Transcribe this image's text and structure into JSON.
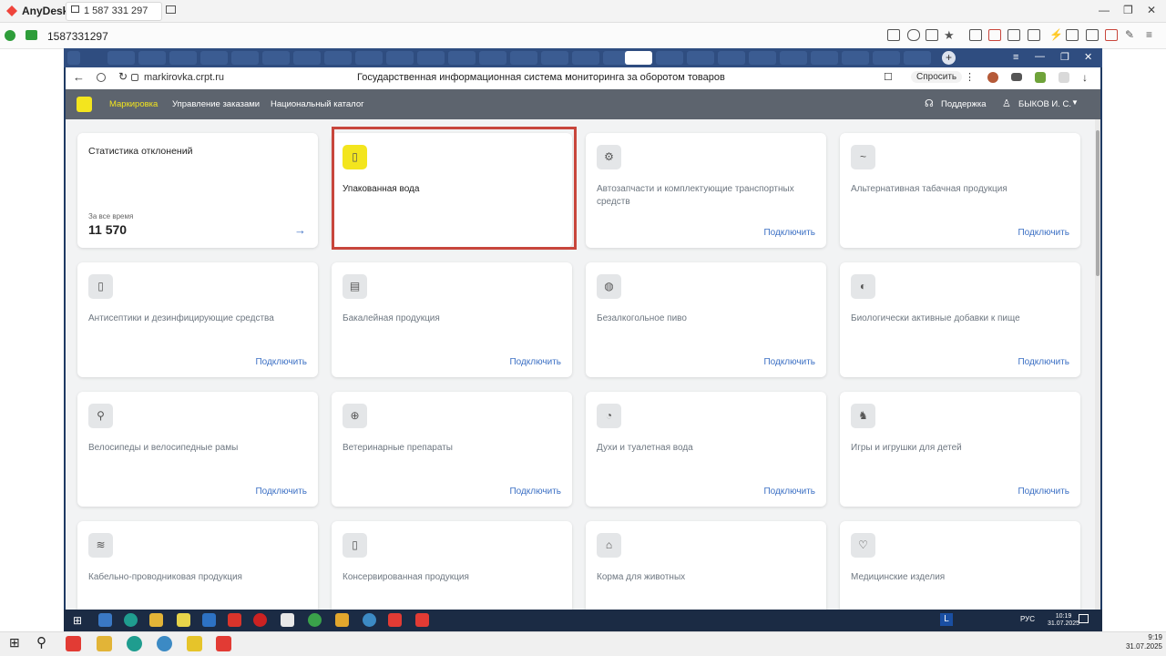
{
  "anydesk": {
    "app_name": "AnyDesk",
    "tab_id": "1 587 331 297",
    "session_id": "1587331297"
  },
  "browser": {
    "url": "markirovka.crpt.ru",
    "page_title": "Государственная информационная система мониторинга за оборотом товаров",
    "ask_button": "Спросить"
  },
  "app": {
    "nav": [
      "Маркировка",
      "Управление заказами",
      "Национальный каталог"
    ],
    "support": "Поддержка",
    "user": "БЫКОВ И. С."
  },
  "stats_card": {
    "title": "Статистика отклонений",
    "period": "За все время",
    "value": "11 570"
  },
  "connect_label": "Подключить",
  "cards": [
    {
      "title": "Упакованная вода",
      "icon": "bottle-icon",
      "selected": true
    },
    {
      "title": "Автозапчасти и комплектующие транспортных средств",
      "icon": "wrench-icon"
    },
    {
      "title": "Альтернативная табачная продукция",
      "icon": "pipe-icon"
    },
    {
      "title": "Антисептики и дезинфицирующие средства",
      "icon": "spray-icon"
    },
    {
      "title": "Бакалейная продукция",
      "icon": "grocery-icon"
    },
    {
      "title": "Безалкогольное пиво",
      "icon": "beer-icon"
    },
    {
      "title": "Биологически активные добавки к пище",
      "icon": "pills-icon"
    },
    {
      "title": "Велосипеды и велосипедные рамы",
      "icon": "bicycle-icon"
    },
    {
      "title": "Ветеринарные препараты",
      "icon": "vet-kit-icon"
    },
    {
      "title": "Духи и туалетная вода",
      "icon": "perfume-icon"
    },
    {
      "title": "Игры и игрушки для детей",
      "icon": "toy-horse-icon"
    },
    {
      "title": "Кабельно-проводниковая продукция",
      "icon": "cable-icon"
    },
    {
      "title": "Консервированная продукция",
      "icon": "can-icon"
    },
    {
      "title": "Корма для животных",
      "icon": "pet-food-icon"
    },
    {
      "title": "Медицинские изделия",
      "icon": "stethoscope-icon"
    }
  ],
  "remote_clock": {
    "time": "10:19",
    "date": "31.07.2025",
    "lang": "РУС"
  },
  "local_clock": {
    "time": "9:19",
    "date": "31.07.2025"
  },
  "colors": {
    "accent_yellow": "#f3e51e",
    "highlight_border": "#c8463c",
    "link_blue": "#3c70c4"
  }
}
